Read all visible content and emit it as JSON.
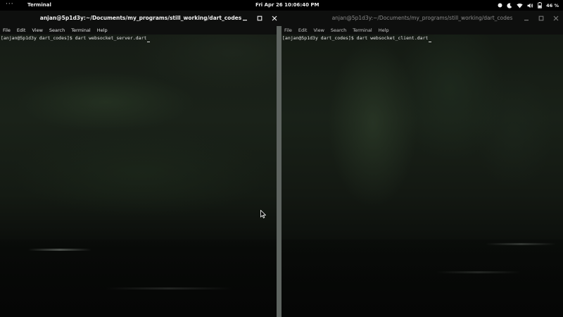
{
  "topbar": {
    "activities": "···",
    "app_name": "Terminal",
    "clock": "Fri Apr 26  10:06:40 PM",
    "battery_pct": "46 %",
    "icons": [
      "record-indicator-icon",
      "night-light-icon",
      "wifi-icon",
      "volume-icon",
      "battery-icon"
    ]
  },
  "windows": [
    {
      "title": "anjan@5p1d3y:~/Documents/my_programs/still_working/dart_codes",
      "menu": [
        "File",
        "Edit",
        "View",
        "Search",
        "Terminal",
        "Help"
      ],
      "prompt": "[anjan@5p1d3y dart_codes]$ dart websocket_server.dart",
      "focused": true
    },
    {
      "title": "anjan@5p1d3y:~/Documents/my_programs/still_working/dart_codes",
      "menu": [
        "File",
        "Edit",
        "View",
        "Search",
        "Terminal",
        "Help"
      ],
      "prompt": "[anjan@5p1d3y dart_codes]$ dart websocket_client.dart",
      "focused": false
    }
  ],
  "colors": {
    "topbar_bg": "#000000",
    "titlebar_bg": "#0e0f0e",
    "divider": "#5e6460",
    "text_focused": "#f0f0f0",
    "text_unfocused": "#8a8a8a"
  }
}
